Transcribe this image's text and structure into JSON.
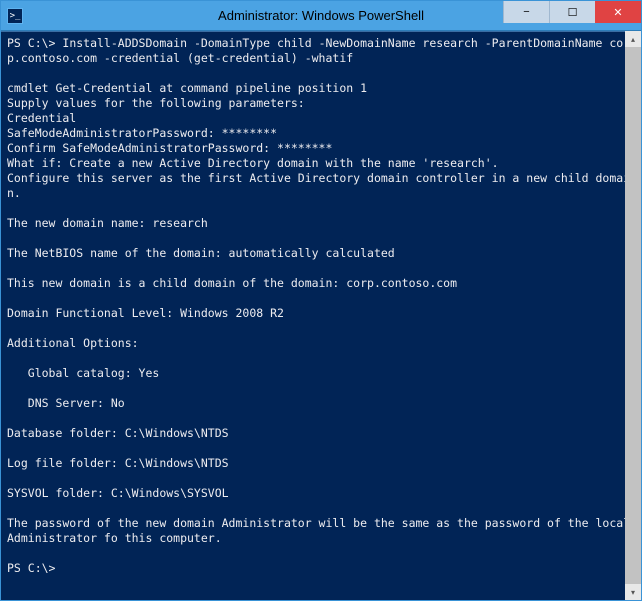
{
  "window": {
    "title": "Administrator: Windows PowerShell",
    "icon_char": ">_"
  },
  "controls": {
    "minimize": "−",
    "maximize": "☐",
    "close": "✕"
  },
  "terminal": {
    "prompt1": "PS C:\\> ",
    "command1": "Install-ADDSDomain -DomainType child -NewDomainName research -ParentDomainName corp.contoso.com -credential (get-credential) -whatif",
    "blank1": "",
    "line3": "cmdlet Get-Credential at command pipeline position 1",
    "line4": "Supply values for the following parameters:",
    "line5": "Credential",
    "line6": "SafeModeAdministratorPassword: ********",
    "line7": "Confirm SafeModeAdministratorPassword: ********",
    "line8": "What if: Create a new Active Directory domain with the name 'research'.",
    "line9": "Configure this server as the first Active Directory domain controller in a new child domain.",
    "blank2": "",
    "line10": "The new domain name: research",
    "blank3": "",
    "line11": "The NetBIOS name of the domain: automatically calculated",
    "blank4": "",
    "line12": "This new domain is a child domain of the domain: corp.contoso.com",
    "blank5": "",
    "line13": "Domain Functional Level: Windows 2008 R2",
    "blank6": "",
    "line14": "Additional Options:",
    "blank7": "",
    "line15": "   Global catalog: Yes",
    "blank8": "",
    "line16": "   DNS Server: No",
    "blank9": "",
    "line17": "Database folder: C:\\Windows\\NTDS",
    "blank10": "",
    "line18": "Log file folder: C:\\Windows\\NTDS",
    "blank11": "",
    "line19": "SYSVOL folder: C:\\Windows\\SYSVOL",
    "blank12": "",
    "line20": "The password of the new domain Administrator will be the same as the password of the local Administrator fo this computer.",
    "blank13": "",
    "prompt2": "PS C:\\>",
    "blank14": ""
  },
  "scrollbar": {
    "up": "▴",
    "down": "▾"
  }
}
